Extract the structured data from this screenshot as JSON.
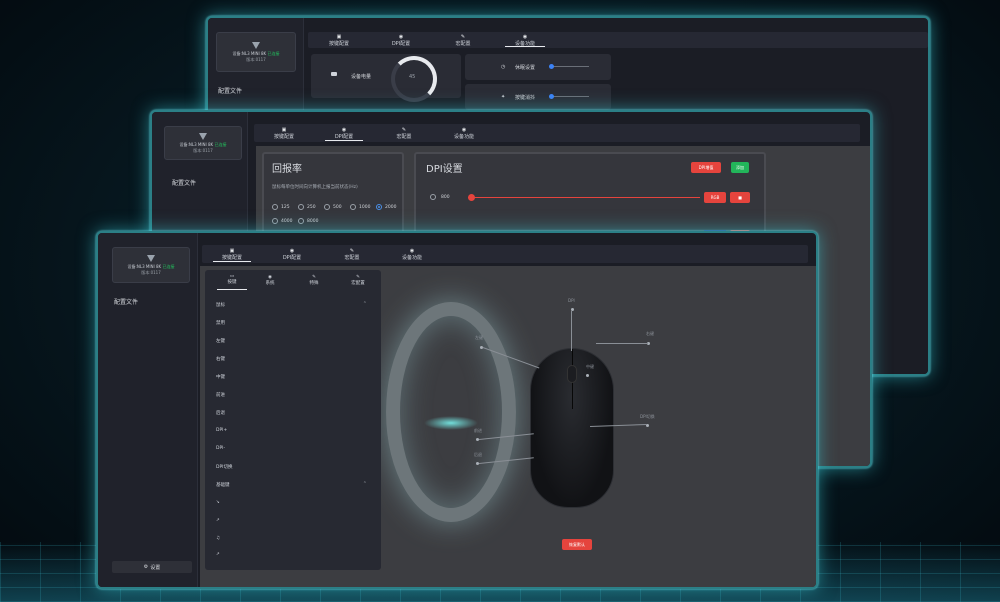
{
  "device": {
    "name_prefix": "设备:NL3 MINI 8K",
    "status": "已连接",
    "version": "版本:0117"
  },
  "back_window": {
    "tabs": [
      {
        "icon": "▣",
        "label": "按键配置"
      },
      {
        "icon": "◉",
        "label": "DPI配置"
      },
      {
        "icon": "✎",
        "label": "宏配置"
      },
      {
        "icon": "◉",
        "label": "设备功能"
      }
    ],
    "sidebar_title": "配置文件",
    "battery_label": "设备电量",
    "battery_value": "45",
    "battery_percent": 45,
    "sleep_label": "休眠设置",
    "debounce_label": "按键消抖"
  },
  "mid_window": {
    "tabs": [
      {
        "icon": "▣",
        "label": "按键配置"
      },
      {
        "icon": "◉",
        "label": "DPI配置"
      },
      {
        "icon": "✎",
        "label": "宏配置"
      },
      {
        "icon": "◉",
        "label": "设备功能"
      }
    ],
    "sidebar_title": "配置文件",
    "polling_title": "回报率",
    "polling_desc": "鼠标每单位时间向计算机上报当前状态(Hz)",
    "polling_options": [
      "125",
      "250",
      "500",
      "1000",
      "2000",
      "4000",
      "8000"
    ],
    "polling_selected": "2000",
    "dpi_title": "DPI设置",
    "dpi_button": "DPI增值",
    "add_button": "添加",
    "dpi_row_value": "800",
    "rgb_button": "RGB"
  },
  "front_window": {
    "tabs": [
      {
        "icon": "▣",
        "label": "按键配置"
      },
      {
        "icon": "◉",
        "label": "DPI配置"
      },
      {
        "icon": "✎",
        "label": "宏配置"
      },
      {
        "icon": "◉",
        "label": "设备功能"
      }
    ],
    "sidebar_title": "配置文件",
    "settings_button": "设置",
    "settings_icon": "gear-icon",
    "menu_tabs": [
      {
        "icon": "▭",
        "label": "按键"
      },
      {
        "icon": "◉",
        "label": "系统"
      },
      {
        "icon": "✎",
        "label": "特殊"
      },
      {
        "icon": "✎",
        "label": "宏配置"
      }
    ],
    "menu_section_1": "鼠标",
    "menu_items": [
      "禁用",
      "左键",
      "右键",
      "中键",
      "前进",
      "后退",
      "DPI+",
      "DPI-",
      "DPI切换"
    ],
    "menu_section_2": "基础键",
    "menu_items_2": [
      "↘",
      "↗",
      "♫",
      "↗"
    ],
    "restore_button": "恢复默认",
    "mouse_labels": [
      "左键",
      "DPI",
      "右键",
      "中键",
      "前进",
      "后退",
      "DPI切换"
    ]
  },
  "colors": {
    "glow": "#2fd0d8",
    "accent_red": "#e5443d",
    "accent_green": "#22b55a",
    "accent_blue": "#4a8fe7"
  }
}
